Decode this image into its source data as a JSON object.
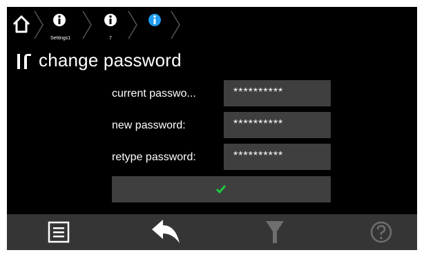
{
  "breadcrumb": {
    "items": [
      {
        "icon": "home-icon"
      },
      {
        "icon": "info-icon",
        "sublabel": "Settings1",
        "color": "#ffffff"
      },
      {
        "icon": "info-icon",
        "sublabel": "7",
        "color": "#ffffff"
      },
      {
        "icon": "info-icon",
        "sublabel": "",
        "color": "#1e9bf0"
      }
    ]
  },
  "header": {
    "icon": "tools-icon",
    "title": "change password"
  },
  "form": {
    "current": {
      "label": "current passwo...",
      "value": "**********"
    },
    "new": {
      "label": "new password:",
      "value": "**********"
    },
    "retype": {
      "label": "retype password:",
      "value": "**********"
    },
    "confirm_icon": "checkmark-icon",
    "confirm_color": "#1ecc3c"
  },
  "footer": {
    "buttons": [
      {
        "icon": "menu-list-icon",
        "enabled": true
      },
      {
        "icon": "back-arrow-icon",
        "enabled": true
      },
      {
        "icon": "filter-icon",
        "enabled": false
      },
      {
        "icon": "help-icon",
        "enabled": false
      }
    ]
  }
}
